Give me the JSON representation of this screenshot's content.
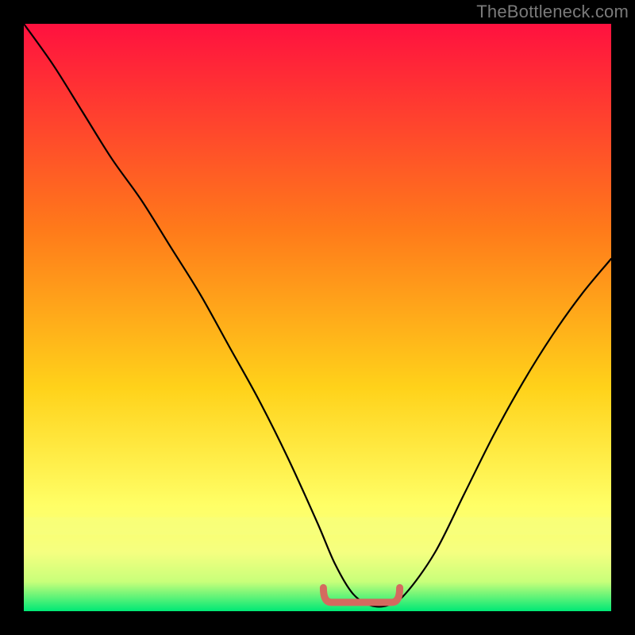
{
  "watermark": "TheBottleneck.com",
  "colors": {
    "bg_top": "#ff113f",
    "bg_mid1": "#ff7a1a",
    "bg_mid2": "#ffd21a",
    "bg_low": "#ffff66",
    "bg_band1": "#f5ff80",
    "bg_band2": "#c8ff7a",
    "bg_bottom": "#00e876",
    "curve": "#000000",
    "marker": "#d46a5f"
  },
  "chart_data": {
    "type": "line",
    "title": "",
    "xlabel": "",
    "ylabel": "",
    "xlim": [
      0,
      100
    ],
    "ylim": [
      0,
      100
    ],
    "series": [
      {
        "name": "bottleneck-curve",
        "x": [
          0,
          5,
          10,
          15,
          20,
          25,
          30,
          35,
          40,
          45,
          50,
          53,
          56,
          59,
          62,
          65,
          70,
          75,
          80,
          85,
          90,
          95,
          100
        ],
        "values": [
          100,
          93,
          85,
          77,
          70,
          62,
          54,
          45,
          36,
          26,
          15,
          8,
          3,
          1,
          1,
          3,
          10,
          20,
          30,
          39,
          47,
          54,
          60
        ]
      }
    ],
    "optimal_marker": {
      "comment": "flat red segment near the curve minimum",
      "x_start": 51,
      "x_end": 64,
      "y": 1.5,
      "end_tick_height": 2.5
    },
    "gradient_stops": [
      {
        "pct": 0,
        "key": "bg_top"
      },
      {
        "pct": 35,
        "key": "bg_mid1"
      },
      {
        "pct": 62,
        "key": "bg_mid2"
      },
      {
        "pct": 82,
        "key": "bg_low"
      },
      {
        "pct": 90,
        "key": "bg_band1"
      },
      {
        "pct": 95,
        "key": "bg_band2"
      },
      {
        "pct": 100,
        "key": "bg_bottom"
      }
    ]
  }
}
